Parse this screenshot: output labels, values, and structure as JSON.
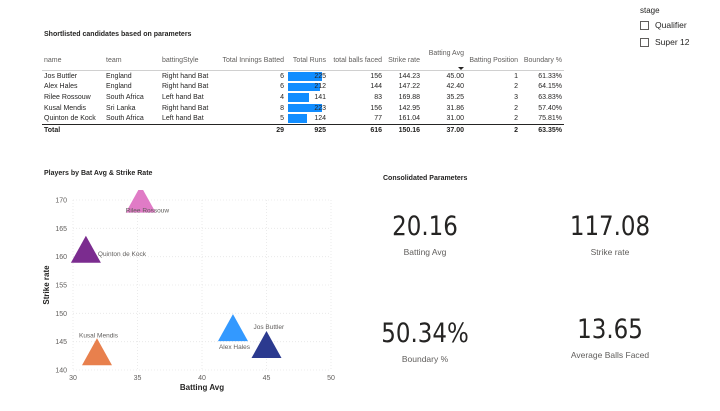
{
  "slicer": {
    "title": "stage",
    "items": [
      {
        "label": "Qualifier"
      },
      {
        "label": "Super 12"
      }
    ]
  },
  "table_visual": {
    "title": "Shortlisted candidates based on parameters",
    "columns": [
      "name",
      "team",
      "battingStyle",
      "Total Innings Batted",
      "Total Runs",
      "total balls faced",
      "Strike rate",
      "Batting Avg",
      "Batting Position",
      "Boundary %"
    ],
    "sorted_column": "Batting Avg",
    "bar_color": "#118dff",
    "rows": [
      {
        "name": "Jos Buttler",
        "team": "England",
        "battingStyle": "Right hand Bat",
        "innings": "6",
        "runs": "225",
        "balls": "156",
        "sr": "144.23",
        "avg": "45.00",
        "pos": "1",
        "boundary": "61.33%"
      },
      {
        "name": "Alex Hales",
        "team": "England",
        "battingStyle": "Right hand Bat",
        "innings": "6",
        "runs": "212",
        "balls": "144",
        "sr": "147.22",
        "avg": "42.40",
        "pos": "2",
        "boundary": "64.15%"
      },
      {
        "name": "Rilee Rossouw",
        "team": "South Africa",
        "battingStyle": "Left hand Bat",
        "innings": "4",
        "runs": "141",
        "balls": "83",
        "sr": "169.88",
        "avg": "35.25",
        "pos": "3",
        "boundary": "63.83%"
      },
      {
        "name": "Kusal Mendis",
        "team": "Sri Lanka",
        "battingStyle": "Right hand Bat",
        "innings": "8",
        "runs": "223",
        "balls": "156",
        "sr": "142.95",
        "avg": "31.86",
        "pos": "2",
        "boundary": "57.40%"
      },
      {
        "name": "Quinton de Kock",
        "team": "South Africa",
        "battingStyle": "Left hand Bat",
        "innings": "5",
        "runs": "124",
        "balls": "77",
        "sr": "161.04",
        "avg": "31.00",
        "pos": "2",
        "boundary": "75.81%"
      }
    ],
    "total": {
      "label": "Total",
      "innings": "29",
      "runs": "925",
      "balls": "616",
      "sr": "150.16",
      "avg": "37.00",
      "pos": "2",
      "boundary": "63.35%"
    }
  },
  "chart_title": "Players by Bat Avg & Strike Rate",
  "chart_data": {
    "type": "scatter",
    "title": "Players by Bat Avg & Strike Rate",
    "xlabel": "Batting Avg",
    "ylabel": "Strike rate",
    "xlim": [
      30,
      50
    ],
    "ylim": [
      140,
      170
    ],
    "xticks": [
      "30",
      "35",
      "40",
      "45",
      "50"
    ],
    "yticks": [
      "140",
      "145",
      "150",
      "155",
      "160",
      "165",
      "170"
    ],
    "grid": true,
    "points": [
      {
        "label": "Jos Buttler",
        "x": 45.0,
        "y": 144.23,
        "color": "#2b3a8f"
      },
      {
        "label": "Alex Hales",
        "x": 42.4,
        "y": 147.22,
        "color": "#3399ff"
      },
      {
        "label": "Rilee Rossouw",
        "x": 35.25,
        "y": 169.88,
        "color": "#e07bc6"
      },
      {
        "label": "Kusal Mendis",
        "x": 31.86,
        "y": 142.95,
        "color": "#e8804d"
      },
      {
        "label": "Quinton de Kock",
        "x": 31.0,
        "y": 161.04,
        "color": "#7b2c8f"
      }
    ]
  },
  "cards_title": "Consolidated Parameters",
  "cards": [
    {
      "value": "20.16",
      "label": "Batting Avg"
    },
    {
      "value": "117.08",
      "label": "Strike rate"
    },
    {
      "value": "50.34%",
      "label": "Boundary %"
    },
    {
      "value": "13.65",
      "label": "Average Balls Faced"
    }
  ]
}
